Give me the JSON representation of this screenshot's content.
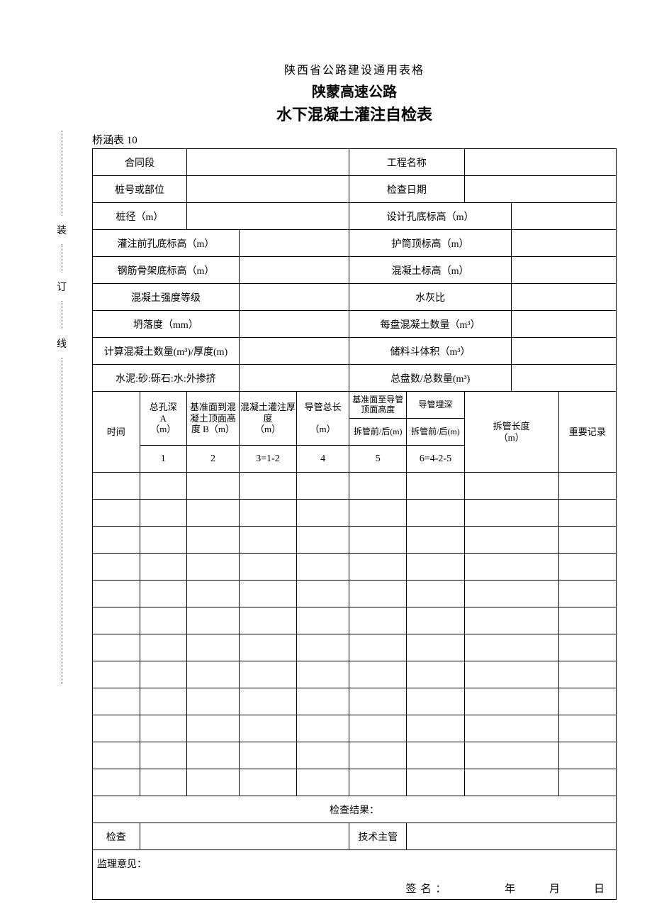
{
  "binding": {
    "c1": "装",
    "c2": "订",
    "c3": "线"
  },
  "header": {
    "line1": "陕西省公路建设通用表格",
    "line2": "陕蒙高速公路",
    "line3": "水下混凝土灌注自检表"
  },
  "table_label": "桥涵表 10",
  "labels": {
    "contract_section": "合同段",
    "project_name": "工程名称",
    "stake_or_part": "桩号或部位",
    "check_date": "检查日期",
    "pile_diameter": "桩径（m）",
    "design_bottom_elev": "设计孔底标高（m）",
    "pre_pour_bottom_elev": "灌注前孔底标高（m）",
    "casing_top_elev": "护筒顶标高（m）",
    "rebar_bottom_elev": "钢筋骨架底标高（m）",
    "concrete_elev": "混凝土标高（m）",
    "concrete_grade": "混凝土强度等级",
    "water_cement_ratio": "水灰比",
    "slump": "坍落度（mm）",
    "per_batch_qty": "每盘混凝土数量（m³）",
    "calc_qty_thickness": "计算混凝土数量(m³)/厚度(m)",
    "hopper_volume": "储料斗体积（m³）",
    "mix_ratio": "水泥:砂:砾石:水:外掺挤",
    "total_batches_qty": "总盘数/总数量(m³)"
  },
  "columns": {
    "time": "时间",
    "total_depth_title": "总孔深",
    "total_depth_sub": "A",
    "total_depth_unit": "（m）",
    "datum_to_top_title": "基准面到混凝土顶面高度 B（m）",
    "pour_thickness_title": "混凝土灌注厚度",
    "pour_thickness_unit": "（m）",
    "tremie_len_title": "导管总长",
    "tremie_len_unit": "（m）",
    "datum_to_pipe_top_l1": "基准面至导管顶面高度",
    "datum_to_pipe_top_l2": "拆管前/后(m)",
    "embed_depth_l1": "导管埋深",
    "embed_depth_l2": "拆管前/后(m)",
    "pipe_remove_len_l1": "拆管长度",
    "pipe_remove_len_l2": "（m）",
    "notes": "重要记录",
    "num1": "1",
    "num2": "2",
    "num3": "3=1-2",
    "num4": "4",
    "num5": "5",
    "num6": "6=4-2-5"
  },
  "footer": {
    "check_result": "检查结果：",
    "inspector": "检查",
    "tech_lead": "技术主管",
    "supervisor_opinion": "监理意见：",
    "signature_line": "签名：　　　　年　　月　　日"
  }
}
